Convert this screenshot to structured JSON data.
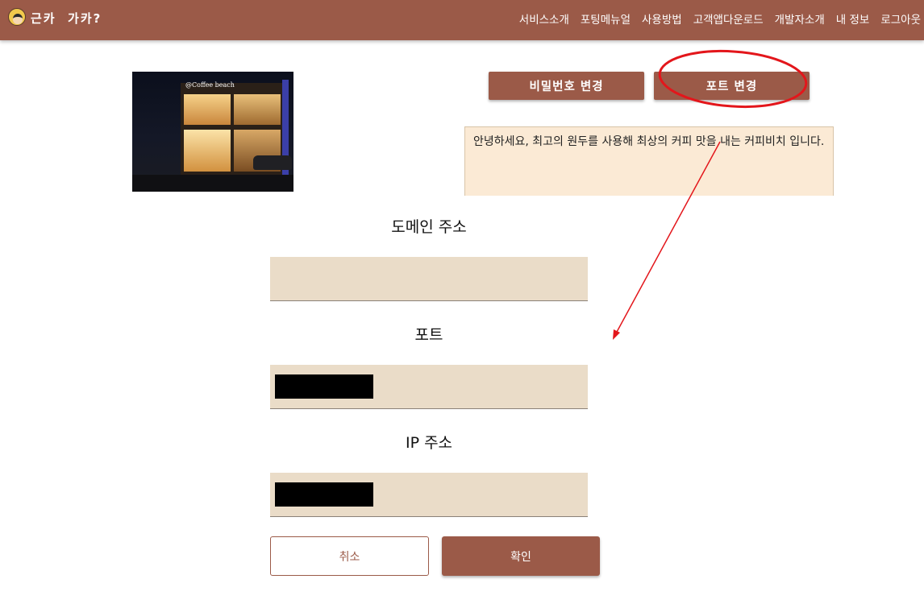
{
  "header": {
    "brand": "근카  가카?",
    "nav": [
      "서비스소개",
      "포팅메뉴얼",
      "사용방법",
      "고객앱다운로드",
      "개발자소개",
      "내 정보",
      "로그아웃"
    ]
  },
  "profile": {
    "photo_sign": "@Coffee beach",
    "change_password_label": "비밀번호 변경",
    "change_port_label": "포트 변경",
    "intro_text": "안녕하세요, 최고의 원두를 사용해 최상의 커피 맛을 내는 커피비치 입니다."
  },
  "form": {
    "domain_label": "도메인 주소",
    "domain_value": "",
    "port_label": "포트",
    "port_value": "",
    "ip_label": "IP 주소",
    "ip_value": "",
    "cancel_label": "취소",
    "confirm_label": "확인"
  },
  "colors": {
    "brand": "#9b5a48",
    "field_bg": "#eadcc8",
    "intro_bg": "#fbead5",
    "annotation": "#e3161b"
  }
}
